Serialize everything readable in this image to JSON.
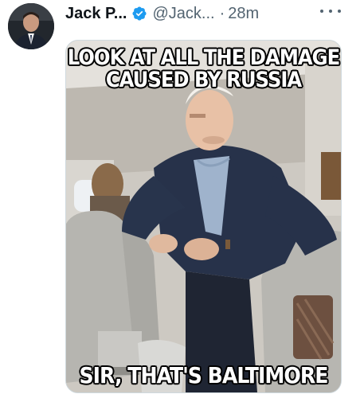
{
  "tweet": {
    "display_name": "Jack P...",
    "handle": "@Jack...",
    "separator": "·",
    "timestamp": "28m",
    "verified_icon": "verified-badge-icon",
    "more_icon": "more-options-icon"
  },
  "meme": {
    "top_text_line1": "LOOK AT ALL THE DAMAGE",
    "top_text_line2": "CAUSED BY RUSSIA",
    "bottom_text": "SIR, THAT'S BALTIMORE"
  },
  "colors": {
    "name": "#0f1419",
    "secondary": "#536471",
    "verified": "#1d9bf0",
    "border": "#cfd9de"
  }
}
